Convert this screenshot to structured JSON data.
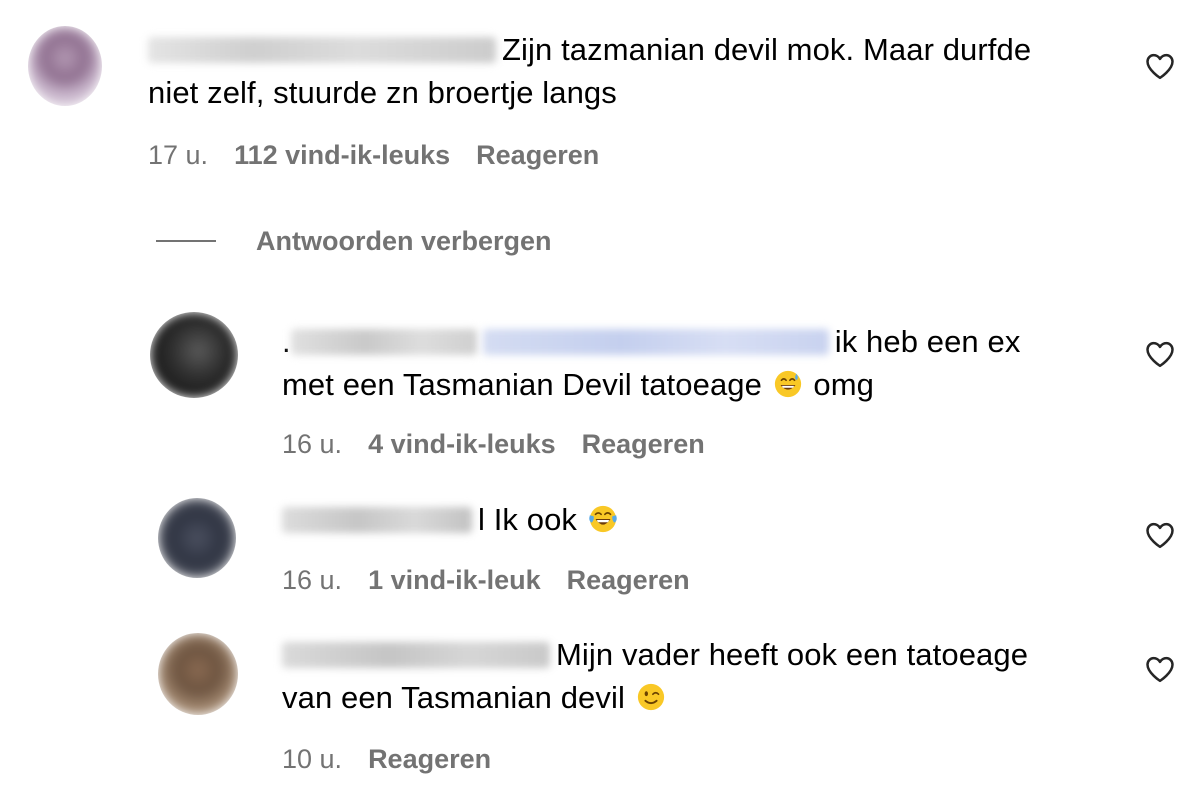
{
  "comments": [
    {
      "text_line1": "Zijn tazmanian devil mok. Maar durfde",
      "text_line2": "niet zelf, stuurde zn broertje langs",
      "time": "17 u.",
      "likes": "112 vind-ik-leuks",
      "reply_label": "Reageren",
      "avatar_icon": "blurred-avatar",
      "heart_icon": "heart-outline-icon"
    },
    {
      "text_line1_prefix": ".",
      "text_line1": "ik heb een ex",
      "text_line2": "met een Tasmanian Devil tatoeage",
      "text_line2_suffix": "omg",
      "emoji": "grinning-face-with-sweat",
      "time": "16 u.",
      "likes": "4 vind-ik-leuks",
      "reply_label": "Reageren",
      "heart_icon": "heart-outline-icon"
    },
    {
      "text_line1": "l Ik ook",
      "emoji": "face-with-tears-of-joy",
      "time": "16 u.",
      "likes": "1 vind-ik-leuk",
      "reply_label": "Reageren",
      "heart_icon": "heart-outline-icon"
    },
    {
      "text_line1": "Mijn vader heeft ook een tatoeage",
      "text_line2": "van een Tasmanian devil",
      "emoji": "winking-face",
      "time": "10 u.",
      "reply_label": "Reageren",
      "heart_icon": "heart-outline-icon"
    }
  ],
  "hide_replies_label": "Antwoorden verbergen",
  "colors": {
    "meta_gray": "#737373",
    "text": "#000000",
    "background": "#ffffff"
  }
}
